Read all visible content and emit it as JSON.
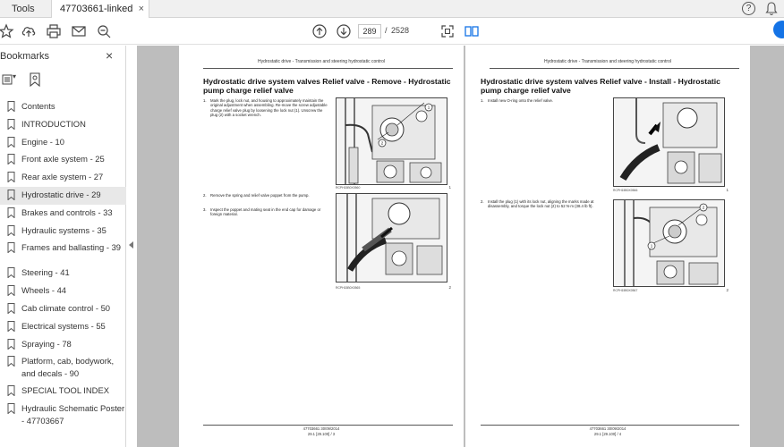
{
  "tabs": {
    "tools": "Tools",
    "document": "47703661-linked pd...",
    "close": "×"
  },
  "header_icons": {
    "help": "?",
    "notifications": "bell-icon"
  },
  "toolbar": {
    "page_current": "289",
    "page_separator": "/",
    "page_total": "2528",
    "icons": [
      "bookmark-star-icon",
      "upload-icon",
      "print-icon",
      "email-icon",
      "zoom-icon",
      "prev-page-icon",
      "next-page-icon",
      "fit-page-icon",
      "two-page-icon"
    ]
  },
  "sidebar": {
    "title": "Bookmarks",
    "close": "×",
    "items": [
      {
        "label": "Contents"
      },
      {
        "label": "INTRODUCTION"
      },
      {
        "label": "Engine - 10"
      },
      {
        "label": "Front axle system - 25"
      },
      {
        "label": "Rear axle system - 27"
      },
      {
        "label": "Hydrostatic drive - 29",
        "selected": true
      },
      {
        "label": "Brakes and controls - 33"
      },
      {
        "label": "Hydraulic systems - 35"
      },
      {
        "label": "Frames and ballasting - 39"
      },
      {
        "label": "Steering - 41"
      },
      {
        "label": "Wheels - 44"
      },
      {
        "label": "Cab climate control - 50"
      },
      {
        "label": "Electrical systems - 55"
      },
      {
        "label": "Spraying - 78"
      },
      {
        "label": "Platform, cab, bodywork, and decals - 90"
      },
      {
        "label": "SPECIAL TOOL INDEX"
      },
      {
        "label": "Hydraulic Schematic Poster - 47703667"
      }
    ]
  },
  "pages": {
    "left": {
      "header": "Hydrostatic drive - Transmission and steering hydrostatic control",
      "title": "Hydrostatic drive system valves Relief valve - Remove - Hydrostatic pump charge relief valve",
      "steps": [
        {
          "num": "1.",
          "text": "Mark the plug, lock nut, and housing to approximately maintain the original adjustment when assembling. Re-move the screw adjustable charge relief valve plug by loosening the lock nut (1). Unscrew the plug (2) with a socket wrench."
        },
        {
          "num": "2.",
          "text": "Remove the spring and relief valve poppet from the pump."
        },
        {
          "num": "3.",
          "text": "Inspect the poppet and mating seat in the end cap for damage or foreign material."
        }
      ],
      "figures": [
        {
          "code": "RCPH15B0X0560",
          "num": "1",
          "callouts": [
            "1",
            "2"
          ]
        },
        {
          "code": "RCPH15B0X0565",
          "num": "2",
          "callouts": []
        }
      ],
      "footer1": "47703661 30/09/2014",
      "footer2": "29.1 [29.100] / 3"
    },
    "right": {
      "header": "Hydrostatic drive - Transmission and steering hydrostatic control",
      "title": "Hydrostatic drive system valves Relief valve - Install - Hydrostatic pump charge relief valve",
      "steps": [
        {
          "num": "1.",
          "text": "Install new O-ring onto the relief valve."
        },
        {
          "num": "2.",
          "text": "Install the plug (1) with its lock nut, aligning the marks made at disassembly, and torque the lock nut (2) to 52 N·m (38.4 lb ft)."
        }
      ],
      "figures": [
        {
          "code": "RCPH15B0X0566",
          "num": "1",
          "callouts": []
        },
        {
          "code": "RCPH15B0X0567",
          "num": "2",
          "callouts": [
            "2",
            "1"
          ]
        }
      ],
      "footer1": "47703661 30/09/2014",
      "footer2": "29.1 [29.100] / 4"
    }
  },
  "colors": {
    "accent": "#1473e6",
    "canvas": "#bdbdbd",
    "selected_bookmark": "#e8e8e8"
  }
}
